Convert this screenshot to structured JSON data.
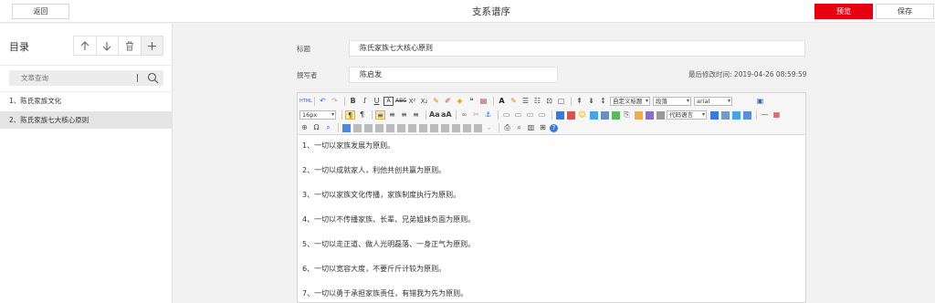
{
  "header": {
    "back_label": "返回",
    "title": "支系谱序",
    "preview_label": "预览",
    "save_label": "保存",
    "accent_color": "#e60012"
  },
  "sidebar": {
    "title": "目录",
    "tools": [
      "move-up-icon",
      "move-down-icon",
      "delete-icon",
      "add-icon"
    ],
    "search_placeholder": "文章查询",
    "items": [
      {
        "label": "1、陈氏家族文化",
        "active": false
      },
      {
        "label": "2、陈氏家族七大核心原则",
        "active": true
      }
    ]
  },
  "form": {
    "title_label": "标题",
    "title_value": "陈氏家族七大核心原则",
    "author_label": "撰写者",
    "author_value": "陈启发",
    "modified_label": "最后修改时间:",
    "modified_value": "2019-04-26 08:59:59"
  },
  "toolbar": {
    "custom_title_select": "自定义标题",
    "paragraph_select": "段落",
    "font_select": "arial",
    "font_size_select": "16px",
    "code_lang_select": "代码语言"
  },
  "content": {
    "lines": [
      "1、一切以家族发展为原则。",
      "2、一切以成就家人，利他共创共赢为原则。",
      "3、一切以家族文化传播，家族制度执行为原则。",
      "4、一切以不传播家族、长辈、兄弟姐妹负面为原则。",
      "5、一切以走正道、做人光明磊落、一身正气为原则。",
      "6、一切以宽容大度，不要斤斤计较为原则。",
      "7、一切以勇于承担家族责任，有错我为先为原则。"
    ]
  }
}
